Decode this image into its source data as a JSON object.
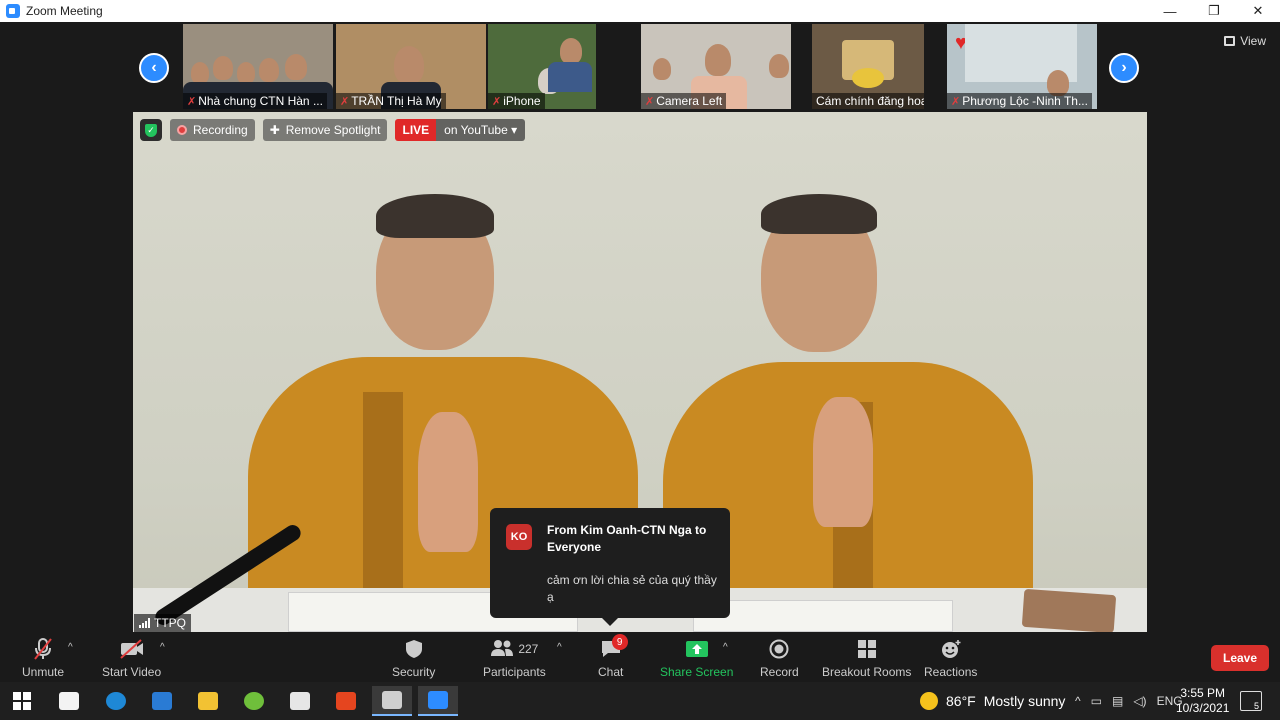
{
  "window": {
    "title": "Zoom Meeting",
    "controls": [
      "—",
      "❐",
      "✕"
    ]
  },
  "thumbnails": [
    {
      "name": "Nhà chung CTN Hàn ...",
      "muted": true,
      "bg": "#9a8f7f"
    },
    {
      "name": "TRẦN Thị Hà My",
      "muted": true,
      "bg": "#b08e64"
    },
    {
      "name": "iPhone",
      "muted": true,
      "bg": "#4e6b3c"
    },
    {
      "name": "Camera Left",
      "muted": true,
      "bg": "#c9c4bb"
    },
    {
      "name": "Cám chính đăng hoa",
      "muted": false,
      "bg": "#6c5a45"
    },
    {
      "name": "Phương Lộc -Ninh Th...",
      "muted": true,
      "bg": "#b7c4c9"
    }
  ],
  "view_label": "View",
  "main": {
    "recording_label": "Recording",
    "spotlight_label": "Remove Spotlight",
    "live_label": "LIVE",
    "live_platform": "on YouTube",
    "speaker_name": "TTPQ"
  },
  "chat_popup": {
    "avatar": "KO",
    "from": "From Kim Oanh-CTN Nga to Everyone",
    "message": "cảm ơn lời chia sẻ của quý thầy ạ"
  },
  "toolbar": {
    "unmute": "Unmute",
    "start_video": "Start Video",
    "security": "Security",
    "participants": "Participants",
    "participants_count": "227",
    "chat": "Chat",
    "chat_badge": "9",
    "share_screen": "Share Screen",
    "record": "Record",
    "breakout": "Breakout Rooms",
    "reactions": "Reactions",
    "leave": "Leave"
  },
  "taskbar": {
    "weather_temp": "86°F",
    "weather_text": "Mostly sunny",
    "lang": "ENG",
    "time": "3:55 PM",
    "date": "10/3/2021",
    "notifications": "5"
  },
  "colors": {
    "accent": "#2d8cff",
    "leave": "#d9302c",
    "green": "#23c45e",
    "robe": "#c98a22"
  }
}
